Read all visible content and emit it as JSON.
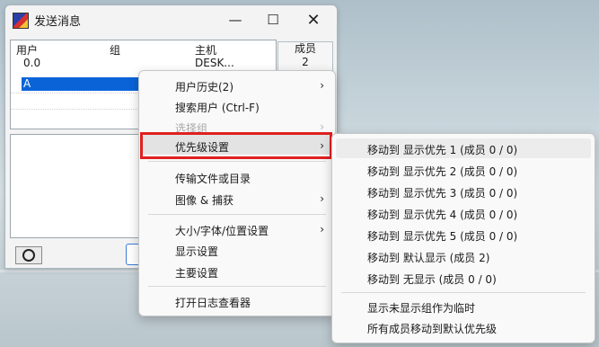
{
  "window": {
    "title": "发送消息",
    "min_glyph": "—",
    "max_glyph": "☐",
    "close_glyph": "✕"
  },
  "user_list": {
    "columns": [
      "用户",
      "组",
      "主机"
    ],
    "rows": [
      {
        "user": "0.0",
        "group": "",
        "host": "DESK..."
      },
      {
        "user": "A",
        "group": "",
        "host": ""
      }
    ],
    "selected_row": 1
  },
  "member_box": {
    "label": "成员",
    "count": "2"
  },
  "context_menu": {
    "items": [
      {
        "label": "用户历史(2)",
        "submenu": true,
        "disabled": false
      },
      {
        "label": "搜索用户 (Ctrl-F)",
        "submenu": false,
        "disabled": false
      },
      {
        "label": "选择组",
        "submenu": true,
        "disabled": true
      },
      {
        "label": "优先级设置",
        "submenu": true,
        "disabled": false,
        "highlighted": true
      },
      {
        "label": "传输文件或目录",
        "submenu": false,
        "disabled": false
      },
      {
        "label": "图像 & 捕获",
        "submenu": true,
        "disabled": false
      },
      {
        "label": "大小/字体/位置设置",
        "submenu": true,
        "disabled": false
      },
      {
        "label": "显示设置",
        "submenu": false,
        "disabled": false
      },
      {
        "label": "主要设置",
        "submenu": false,
        "disabled": false
      },
      {
        "label": "打开日志查看器",
        "submenu": false,
        "disabled": false
      }
    ],
    "arrow_glyph": "›"
  },
  "priority_submenu": {
    "items": [
      "移动到 显示优先 1 (成员  0 /  0)",
      "移动到 显示优先 2 (成员  0 /  0)",
      "移动到 显示优先 3 (成员  0 /  0)",
      "移动到 显示优先 4 (成员  0 /  0)",
      "移动到 显示优先 5 (成员  0 /  0)",
      "移动到 默认显示   (成员  2)",
      "移动到 无显示   (成员  0 /  0)",
      "显示未显示组作为临时",
      "所有成员移动到默认优先级"
    ]
  },
  "colors": {
    "highlight_border": "#e02020",
    "selection": "#0a64d8"
  }
}
